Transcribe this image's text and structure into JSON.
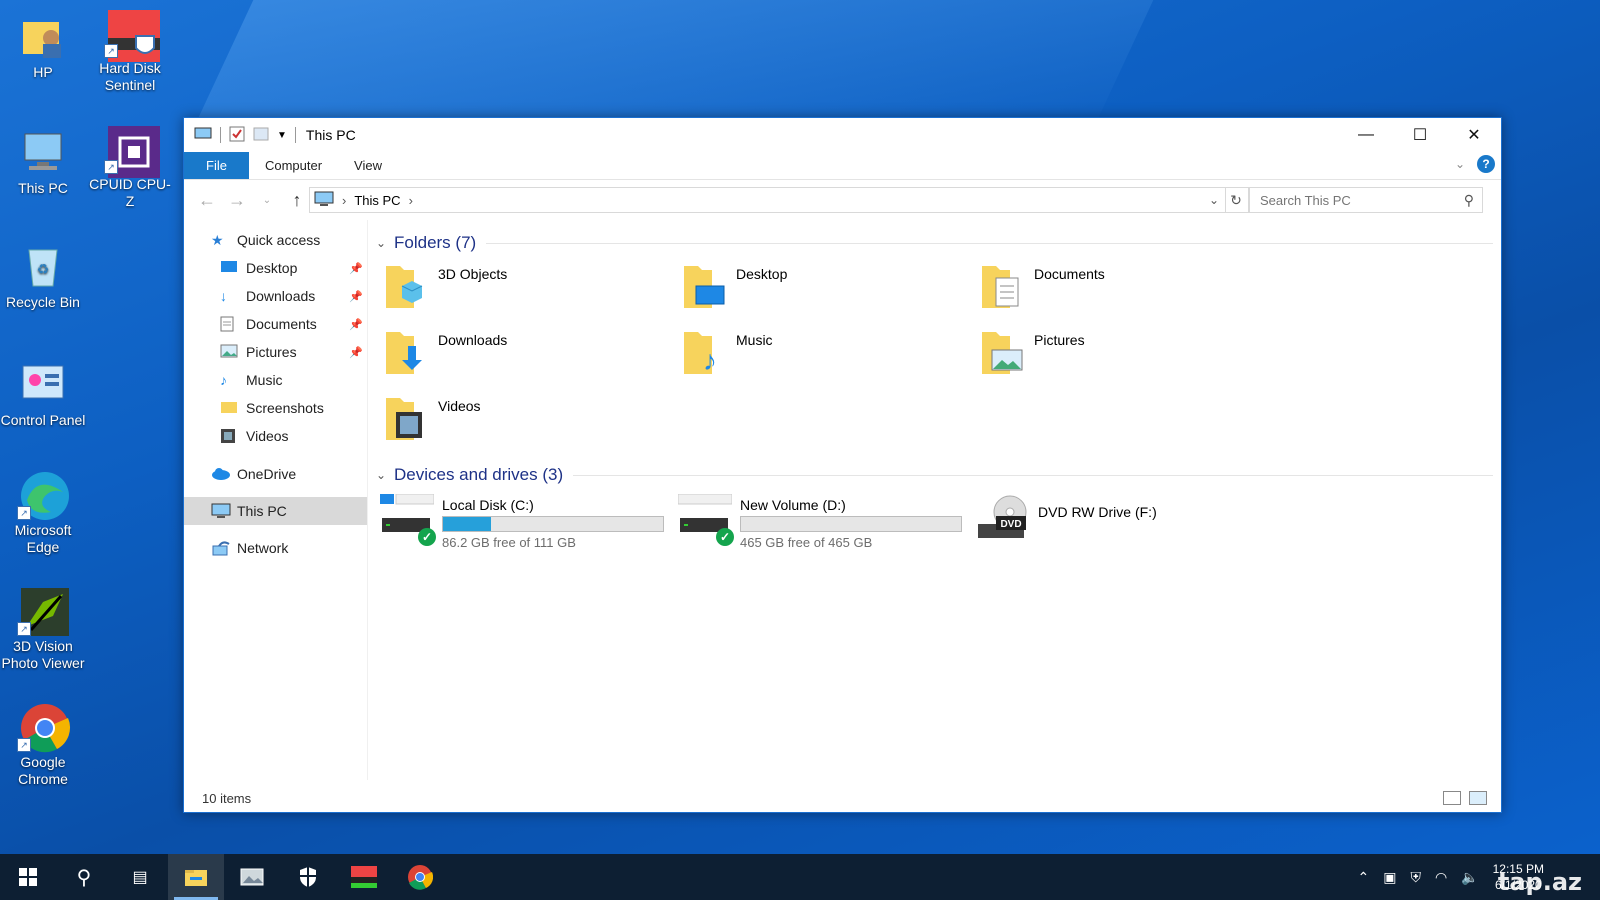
{
  "desktop": {
    "icons": [
      {
        "label": "HP"
      },
      {
        "label": "Hard Disk Sentinel"
      },
      {
        "label": "This PC"
      },
      {
        "label": "CPUID CPU-Z"
      },
      {
        "label": "Recycle Bin"
      },
      {
        "label": "Control Panel"
      },
      {
        "label": "Microsoft Edge"
      },
      {
        "label": "3D Vision Photo Viewer"
      },
      {
        "label": "Google Chrome"
      }
    ]
  },
  "window": {
    "title": "This PC",
    "ribbon_tabs": [
      "File",
      "Computer",
      "View"
    ],
    "address": {
      "crumb": "This PC"
    },
    "search": {
      "placeholder": "Search This PC"
    },
    "nav": {
      "quick_access": "Quick access",
      "quick_items": [
        "Desktop",
        "Downloads",
        "Documents",
        "Pictures",
        "Music",
        "Screenshots",
        "Videos"
      ],
      "onedrive": "OneDrive",
      "this_pc": "This PC",
      "network": "Network"
    },
    "folders_header": "Folders (7)",
    "folders": [
      "3D Objects",
      "Desktop",
      "Documents",
      "Downloads",
      "Music",
      "Pictures",
      "Videos"
    ],
    "drives_header": "Devices and drives (3)",
    "drives": [
      {
        "name": "Local Disk (C:)",
        "free": "86.2 GB free of 111 GB",
        "used_fraction": 0.22
      },
      {
        "name": "New Volume (D:)",
        "free": "465 GB free of 465 GB",
        "used_fraction": 0.0
      },
      {
        "name": "DVD RW Drive (F:)"
      }
    ],
    "dvd_label": "DVD",
    "status": "10 items"
  },
  "taskbar": {
    "time": "12:15 PM",
    "date": "6/1/2020",
    "watermark": "tap.az"
  },
  "colors": {
    "accent": "#1979ca",
    "drive_fill": "#26a0da",
    "folder_yellow": "#f7d35c"
  }
}
